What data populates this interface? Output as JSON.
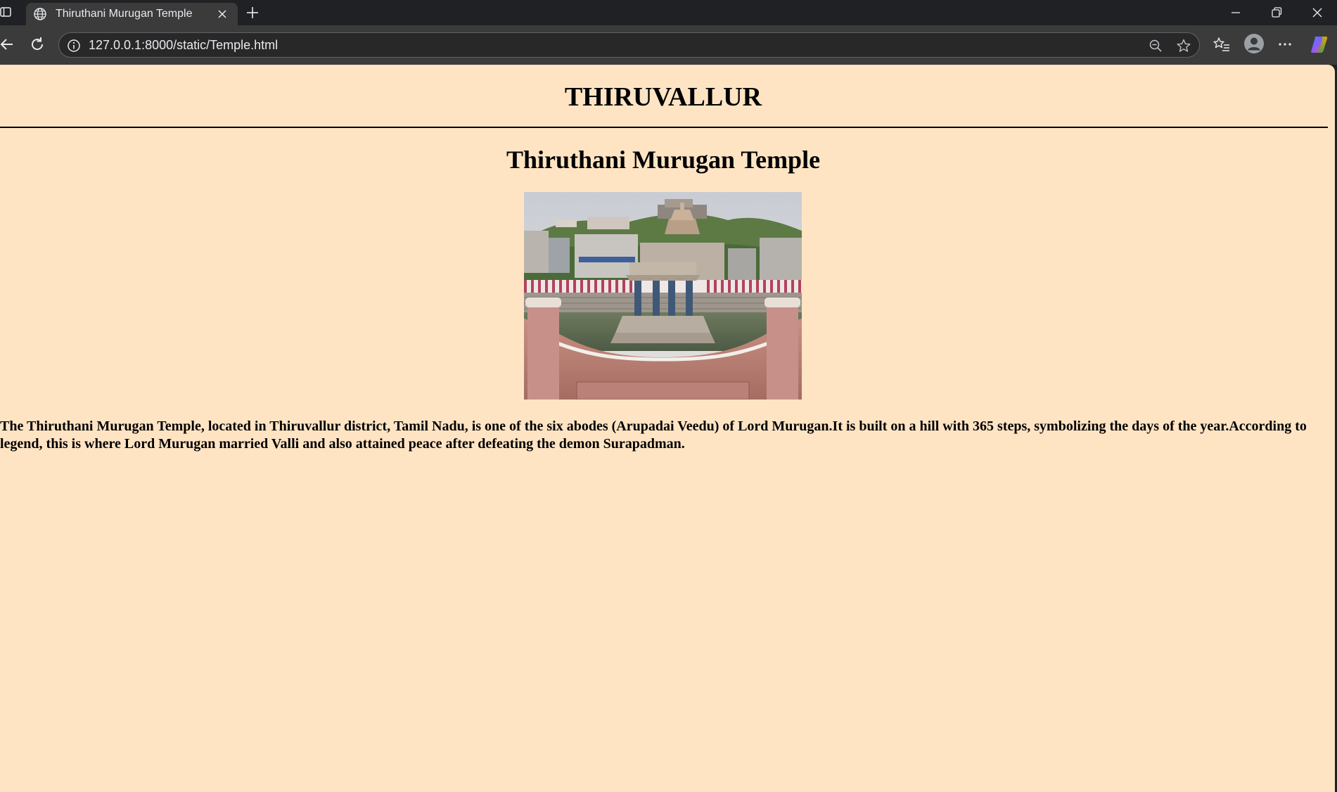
{
  "browser": {
    "tab": {
      "title": "Thiruthani Murugan Temple",
      "favicon": "globe-icon"
    },
    "address_bar": {
      "url": "127.0.0.1:8000/static/Temple.html"
    },
    "toolbar_icons": [
      "back-icon",
      "reload-icon",
      "site-info-icon",
      "zoom-out-icon",
      "favorite-star-icon",
      "favorites-icon",
      "profile-icon",
      "more-icon",
      "copilot-icon"
    ],
    "window_icons": [
      "minimize-icon",
      "restore-icon",
      "close-window-icon"
    ]
  },
  "page": {
    "background": "#ffe4c4",
    "header": "THIRUVALLUR",
    "title": "Thiruthani Murugan Temple",
    "image": "temple-photo",
    "description": "The Thiruthani Murugan Temple, located in Thiruvallur district, Tamil Nadu, is one of the six abodes (Arupadai Veedu) of Lord Murugan.It is built on a hill with 365 steps, symbolizing the days of the year.According to legend, this is where Lord Murugan married Valli and also attained peace after defeating the demon Surapadman."
  }
}
